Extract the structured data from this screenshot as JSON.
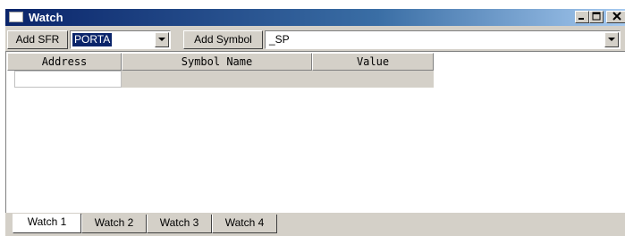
{
  "window": {
    "title": "Watch",
    "controls": {
      "minimize": "_",
      "restore": "□",
      "close": "×"
    }
  },
  "toolbar": {
    "add_sfr_label": "Add SFR",
    "sfr_select_value": "PORTA",
    "add_symbol_label": "Add Symbol",
    "symbol_select_value": "_SP"
  },
  "columns": [
    "Address",
    "Symbol Name",
    "Value"
  ],
  "tabs": [
    "Watch 1",
    "Watch 2",
    "Watch 3",
    "Watch 4"
  ],
  "active_tab": "Watch 1",
  "colors": {
    "titlebar_start": "#0a246a",
    "titlebar_end": "#a6caf0",
    "face": "#d4d0c8",
    "selection": "#0a246a"
  }
}
